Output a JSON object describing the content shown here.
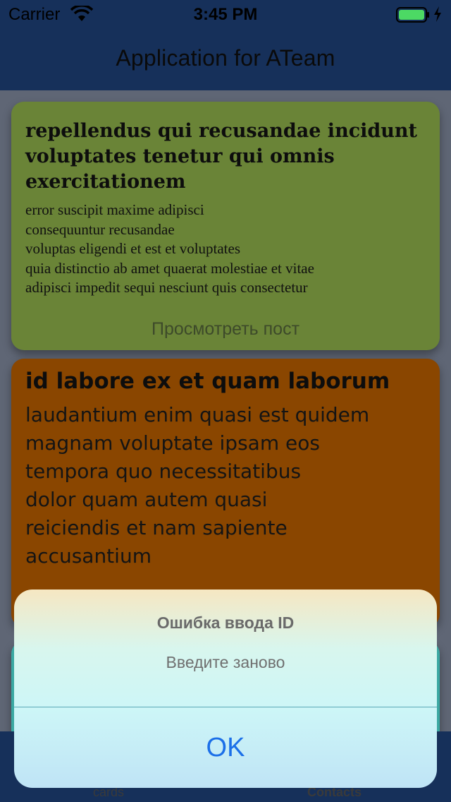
{
  "status_bar": {
    "carrier": "Carrier",
    "time": "3:45 PM"
  },
  "nav": {
    "title": "Application for ATeam"
  },
  "cards": [
    {
      "title": "repellendus qui recusandae incidunt voluptates tenetur qui omnis exercitationem",
      "body_lines": [
        "error suscipit maxime adipisci",
        "consequuntur recusandae",
        "voluptas eligendi et est et voluptates",
        "quia distinctio ab amet quaerat molestiae et vitae",
        "adipisci impedit sequi nesciunt quis consectetur"
      ],
      "link": "Просмотреть пост",
      "color": "#6a8437"
    },
    {
      "title": "id labore ex et quam laborum",
      "body_lines": [
        "laudantium enim quasi est quidem",
        "magnam voluptate ipsam eos",
        "tempora quo necessitatibus",
        "dolor quam autem quasi",
        "reiciendis et nam sapiente",
        "accusantium"
      ],
      "color": "#8a4600"
    },
    {
      "color": "#3ba8a2"
    }
  ],
  "tabs": [
    {
      "label": "cards"
    },
    {
      "label": "Contacts"
    }
  ],
  "alert": {
    "title": "Ошибка ввода ID",
    "message": "Введите заново",
    "ok_label": "OK"
  }
}
